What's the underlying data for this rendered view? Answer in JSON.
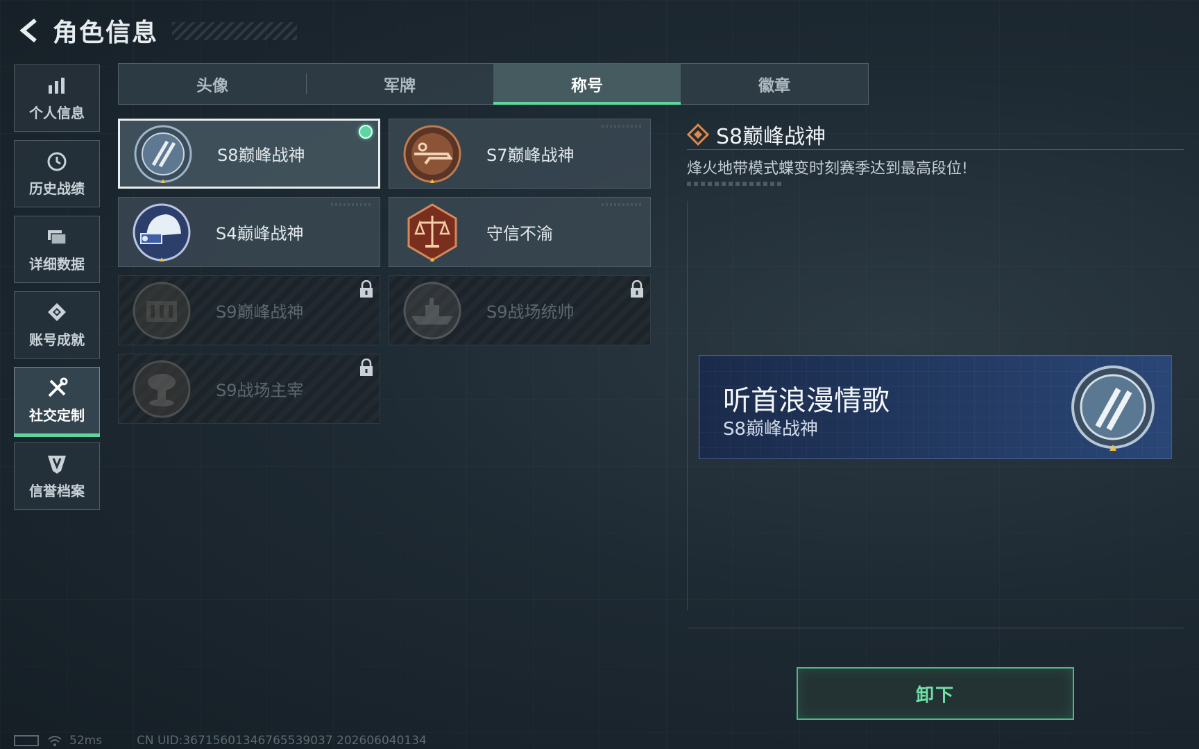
{
  "header": {
    "title": "角色信息"
  },
  "sidebar": {
    "items": [
      {
        "label": "个人信息",
        "icon": "bar-chart-icon"
      },
      {
        "label": "历史战绩",
        "icon": "history-clock-icon"
      },
      {
        "label": "详细数据",
        "icon": "folder-icon"
      },
      {
        "label": "账号成就",
        "icon": "achievement-icon"
      },
      {
        "label": "社交定制",
        "icon": "tools-icon",
        "active": true
      },
      {
        "label": "信誉档案",
        "icon": "credit-shield-icon"
      }
    ]
  },
  "tabs": [
    {
      "label": "头像"
    },
    {
      "label": "军牌"
    },
    {
      "label": "称号",
      "active": true
    },
    {
      "label": "徽章"
    }
  ],
  "titles": [
    {
      "name": "S8巅峰战神",
      "selected": true,
      "equipped": true,
      "locked": false,
      "medal": "peak-medal-blue"
    },
    {
      "name": "S7巅峰战神",
      "selected": false,
      "equipped": false,
      "locked": false,
      "medal": "rifle-medal-bronze"
    },
    {
      "name": "S4巅峰战神",
      "selected": false,
      "equipped": false,
      "locked": false,
      "medal": "helmet-medal-blue"
    },
    {
      "name": "守信不渝",
      "selected": false,
      "equipped": false,
      "locked": false,
      "medal": "scales-medal-red"
    },
    {
      "name": "S9巅峰战神",
      "selected": false,
      "equipped": false,
      "locked": true,
      "medal": "fortress-medal"
    },
    {
      "name": "S9战场统帅",
      "selected": false,
      "equipped": false,
      "locked": true,
      "medal": "warship-medal"
    },
    {
      "name": "S9战场主宰",
      "selected": false,
      "equipped": false,
      "locked": true,
      "medal": "mushroom-cloud-medal"
    }
  ],
  "detail": {
    "name": "S8巅峰战神",
    "description": "烽火地带模式蝶变时刻赛季达到最高段位!"
  },
  "preview": {
    "player_name": "听首浪漫情歌",
    "title": "S8巅峰战神"
  },
  "actions": {
    "unequip_label": "卸下"
  },
  "footer": {
    "ping": "52ms",
    "uid": "CN UID:367156013467655390​37 202606040134"
  },
  "colors": {
    "accent": "#5fd6a0",
    "banner": "#233a62",
    "detail_icon": "#e0884a"
  }
}
